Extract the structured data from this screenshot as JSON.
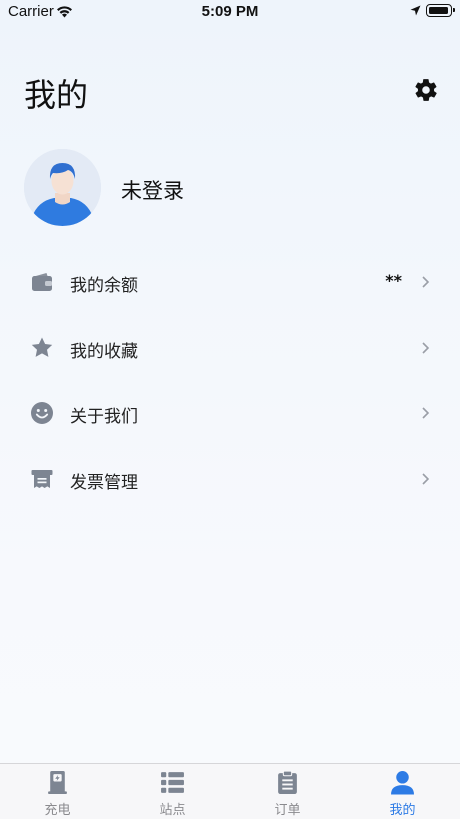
{
  "status_bar": {
    "carrier": "Carrier",
    "time": "5:09 PM"
  },
  "page": {
    "title": "我的"
  },
  "profile": {
    "login_text": "未登录"
  },
  "menu": [
    {
      "label": "我的余额",
      "value": "**",
      "icon": "wallet-icon"
    },
    {
      "label": "我的收藏",
      "value": "",
      "icon": "star-icon"
    },
    {
      "label": "关于我们",
      "value": "",
      "icon": "smiley-icon"
    },
    {
      "label": "发票管理",
      "value": "",
      "icon": "invoice-icon"
    }
  ],
  "tabbar": [
    {
      "label": "充电",
      "icon": "charging-station-icon",
      "active": false
    },
    {
      "label": "站点",
      "icon": "list-icon",
      "active": false
    },
    {
      "label": "订单",
      "icon": "clipboard-icon",
      "active": false
    },
    {
      "label": "我的",
      "icon": "person-icon",
      "active": true
    }
  ],
  "colors": {
    "accent": "#2d7be5",
    "icon_gray": "#7d8592",
    "inactive_tab": "#8a8a8e"
  }
}
